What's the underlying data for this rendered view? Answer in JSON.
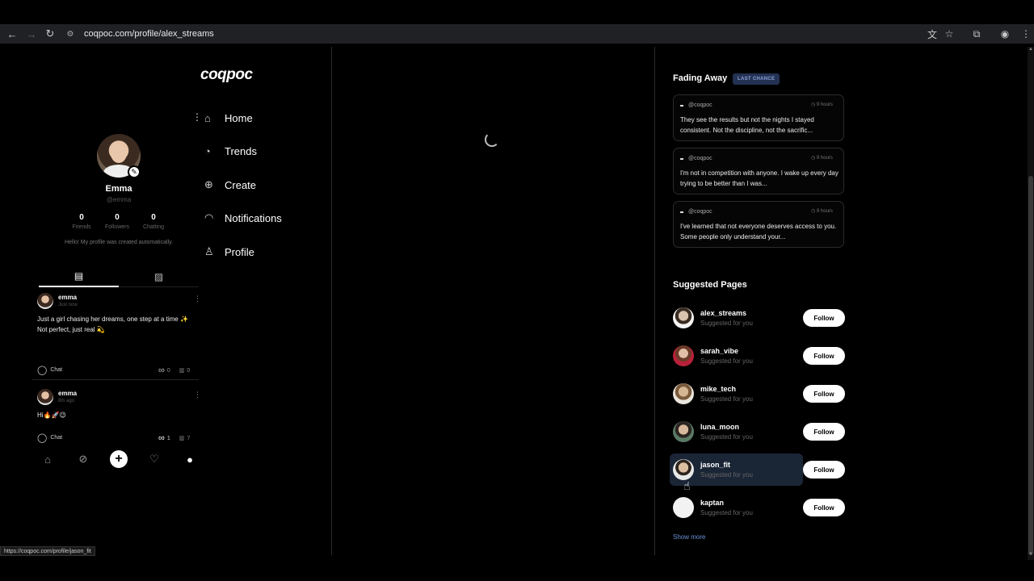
{
  "browser": {
    "url": "coqpoc.com/profile/alex_streams",
    "status_url": "https://coqpoc.com/profile/jason_fit"
  },
  "logo": "coqpoc",
  "profile": {
    "name": "Emma",
    "handle": "@emma",
    "stats": [
      {
        "value": "0",
        "label": "Friends"
      },
      {
        "value": "0",
        "label": "Followers"
      },
      {
        "value": "0",
        "label": "Chatting"
      }
    ],
    "bio": "Hello! My profile was created automatically."
  },
  "posts": [
    {
      "user": "emma",
      "time": "Just now",
      "text": "Just a girl chasing her dreams, one step at a time ✨\nNot perfect, just real 💫",
      "chat_label": "Chat",
      "loops": "0",
      "views": "0"
    },
    {
      "user": "emma",
      "time": "8m ago",
      "text": "Hi🔥🚀😉",
      "chat_label": "Chat",
      "loops": "1",
      "views": "7"
    }
  ],
  "side_nav": [
    {
      "label": "Home",
      "icon": "home-icon"
    },
    {
      "label": "Trends",
      "icon": "trends-icon"
    },
    {
      "label": "Create",
      "icon": "create-icon"
    },
    {
      "label": "Notifications",
      "icon": "notifications-icon"
    },
    {
      "label": "Profile",
      "icon": "profile-icon"
    }
  ],
  "fading": {
    "title": "Fading Away",
    "badge": "LAST CHANCE",
    "cards": [
      {
        "author": "@coqpoc",
        "time": "9 hours",
        "text": "They see the results but not the nights I stayed consistent. Not the discipline, not the sacrific..."
      },
      {
        "author": "@coqpoc",
        "time": "9 hours",
        "text": "I'm not in competition with anyone. I wake up every day trying to be better than I was..."
      },
      {
        "author": "@coqpoc",
        "time": "9 hours",
        "text": "I've learned that not everyone deserves access to you. Some people only understand your..."
      }
    ]
  },
  "suggested": {
    "title": "Suggested Pages",
    "follow_label": "Follow",
    "show_more": "Show more",
    "items": [
      {
        "username": "alex_streams",
        "subtitle": "Suggested for you",
        "avatar_color": "#d9c2ae"
      },
      {
        "username": "sarah_vibe",
        "subtitle": "Suggested for you",
        "avatar_color": "#b8213a"
      },
      {
        "username": "mike_tech",
        "subtitle": "Suggested for you",
        "avatar_color": "#c9b18f"
      },
      {
        "username": "luna_moon",
        "subtitle": "Suggested for you",
        "avatar_color": "#5a7a66"
      },
      {
        "username": "jason_fit",
        "subtitle": "Suggested for you",
        "avatar_color": "#e8e8e8"
      },
      {
        "username": "kaptan",
        "subtitle": "Suggested for you",
        "avatar_color": "#f2f2f2"
      }
    ]
  },
  "colors": {
    "background": "#000000",
    "badge_bg": "#233152",
    "link": "#6d8fd6",
    "hover_row": "#1a2536"
  }
}
